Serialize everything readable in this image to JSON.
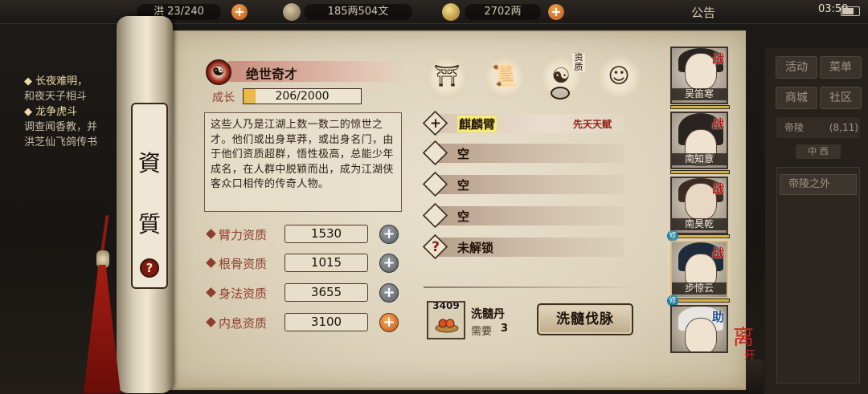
{
  "topbar": {
    "resource1": "23/240",
    "resource1_prefix": "洪",
    "copper": "185两504文",
    "silver": "2702两",
    "notice": "公告",
    "clock": "03:59"
  },
  "quest": {
    "lines": [
      "◆ 长夜难明，",
      "和夜天子相斗",
      "◆ 龙争虎斗",
      "调查闻香教，并",
      "洪芝仙飞鸽传书"
    ]
  },
  "right_menu": {
    "buttons": [
      "活动",
      "菜单",
      "商城",
      "社区"
    ],
    "location": "帝陵",
    "location_coords": "(8,11)",
    "location_tag": "中 西",
    "sub_item": "帝陵之外"
  },
  "scroll": {
    "title_chars": [
      "資",
      "質"
    ],
    "help_icon": "?"
  },
  "talent": {
    "icon": "yin-yang-icon",
    "name": "绝世奇才",
    "growth_label": "成长",
    "growth_value": "206/2000",
    "growth_fraction": 0.103,
    "description": "这些人乃是江湖上数一数二的惊世之才。他们或出身草莽，或出身名门，由于他们资质超群，悟性极高，总能少年成名，在人群中脱颖而出，成为江湖侠客众口相传的传奇人物。"
  },
  "attributes": [
    {
      "label": "臂力资质",
      "value": "1530",
      "button": "plus-button-gray"
    },
    {
      "label": "根骨资质",
      "value": "1015",
      "button": "plus-button-gray"
    },
    {
      "label": "身法资质",
      "value": "3655",
      "button": "plus-button-gray"
    },
    {
      "label": "内息资质",
      "value": "3100",
      "button": "plus-button-orange"
    }
  ],
  "tabs": [
    {
      "icon": "hat-icon"
    },
    {
      "icon": "scroll-icon"
    },
    {
      "icon": "bagua-icon",
      "label": "资质"
    },
    {
      "icon": "body-meridian-icon"
    }
  ],
  "skills": [
    {
      "symbol": "+",
      "name": "麒麟臂",
      "tag": "先天天赋"
    },
    {
      "symbol": "",
      "name": "空",
      "tag": ""
    },
    {
      "symbol": "",
      "name": "空",
      "tag": ""
    },
    {
      "symbol": "",
      "name": "空",
      "tag": ""
    },
    {
      "symbol": "?",
      "name": "未解锁",
      "tag": ""
    }
  ],
  "item": {
    "count": "3409",
    "name": "洗髓丹",
    "need_label": "需要",
    "need_value": "3",
    "action": "洗髓伐脉"
  },
  "party": [
    {
      "name": "吴笛寒",
      "badge": "战",
      "hp": 1.0,
      "xiu": ""
    },
    {
      "name": "南知意",
      "badge": "战",
      "hp": 1.0,
      "xiu": ""
    },
    {
      "name": "南昊乾",
      "badge": "战",
      "hp": 1.0,
      "xiu": "修"
    },
    {
      "name": "步惊云",
      "badge": "战",
      "hp": 1.0,
      "xiu": "修"
    },
    {
      "name": "",
      "badge": "助",
      "hp": 0,
      "xiu": ""
    }
  ],
  "leave_button": {
    "line1": "离",
    "line2": "开"
  }
}
